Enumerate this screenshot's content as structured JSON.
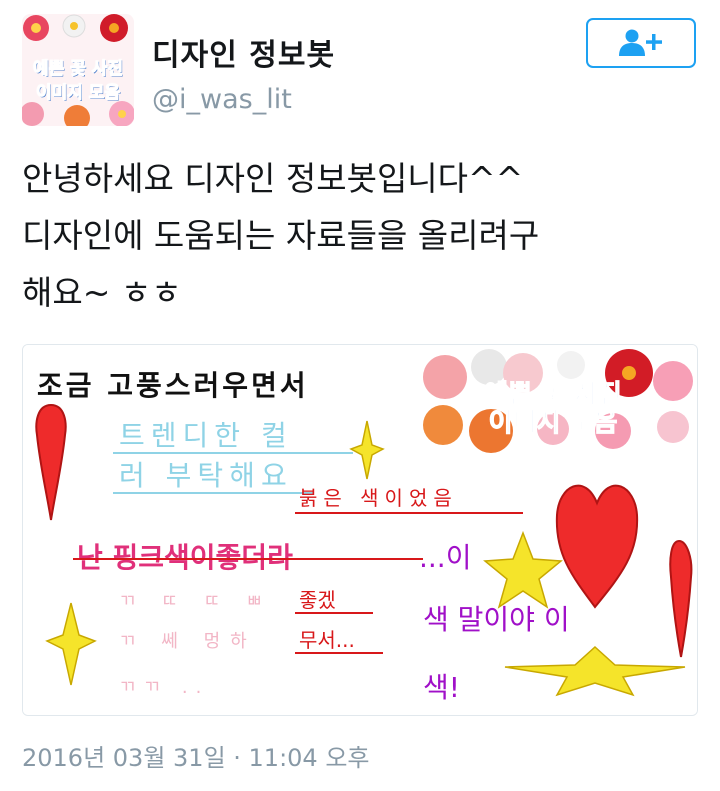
{
  "profile": {
    "avatar_text_line1": "예쁜 꽃 사진",
    "avatar_text_line2": "이미지 모음",
    "display_name": "디자인 정보봇",
    "handle": "@i_was_lit",
    "follow_icon": "add-user-icon"
  },
  "tweet": {
    "text": "안녕하세요 디자인 정보봇입니다^^\n디자인에 도움되는 자료들을 올리려구\n해요~ ㅎㅎ",
    "timestamp": "2016년 03월 31일 · 11:04 오후"
  },
  "media": {
    "line_heading": "조금 고풍스러우면서",
    "line_trendy1": "트렌디한 컬",
    "line_trendy2": "러 부탁해요",
    "line_pink": "난 핑크색이좋더라",
    "line_dots_i": "...이",
    "line_red1": "붉은 색이었음",
    "line_red2": "좋겠",
    "line_red3": "무서...",
    "line_color": "색 말이야 이",
    "line_color2": "색!",
    "line_faint1": "ㄲ ㄸ ㄸ ㅃ",
    "line_faint2": "ㄲ 쎄 멍하",
    "line_faint3": "ㄲㄲ ..",
    "banner_line1": "예쁜 꽃 사진",
    "banner_line2": "이미지 모음",
    "colors": {
      "pink": "#e0307a",
      "cyan": "#8fd3e6",
      "red": "#d8181a",
      "magenta": "#a010c8",
      "heart": "#ee2b2b",
      "star": "#f5e42a"
    }
  }
}
